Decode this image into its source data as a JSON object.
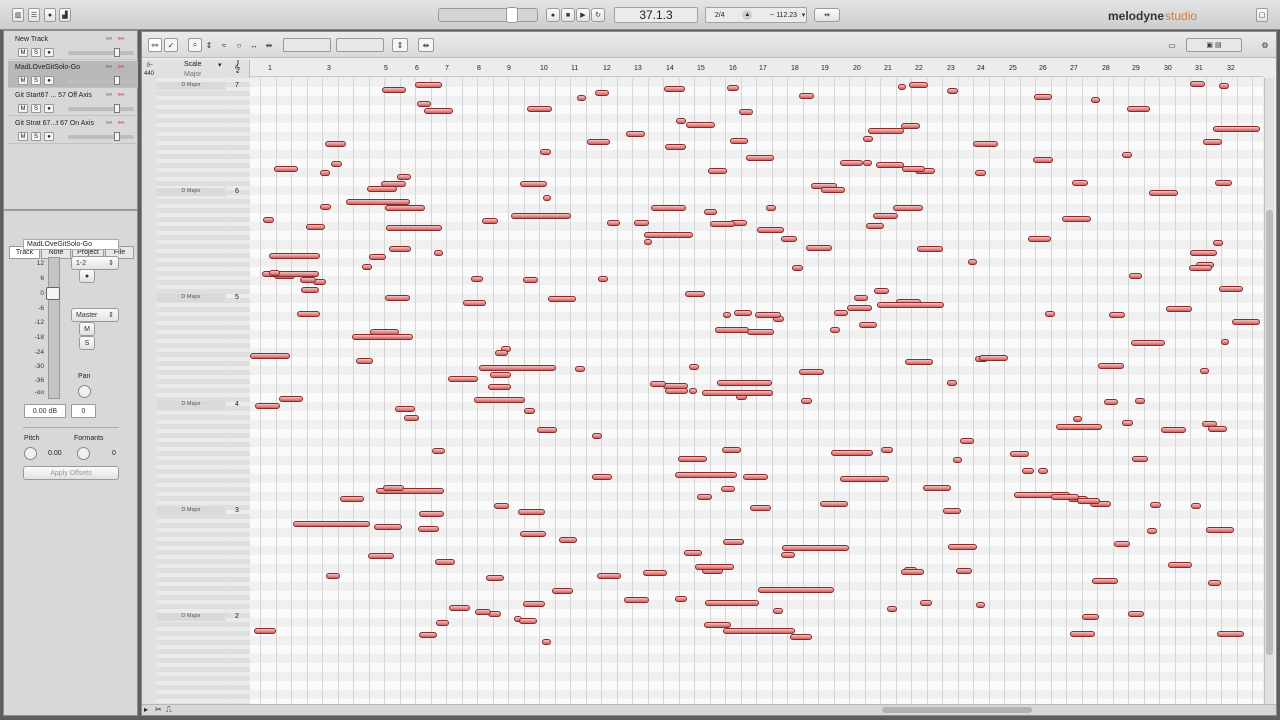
{
  "transport": {
    "position": "37.1.3",
    "signature": "2/4",
    "tempo": "112.23",
    "app_name": "melodyne",
    "app_edition": "studio"
  },
  "tracks": [
    {
      "name": "New Track",
      "selected": false
    },
    {
      "name": "MadLOveGitSolo-Go",
      "selected": true
    },
    {
      "name": "Git Start67 ... 57 Off Axis",
      "selected": false
    },
    {
      "name": "Git Strat 67...t 67 On Axis",
      "selected": false
    }
  ],
  "mini_labels": {
    "mute": "M",
    "solo": "S",
    "record": "●"
  },
  "inspector": {
    "tabs": [
      "Track",
      "Note",
      "Project",
      "File"
    ],
    "track_name": "MadLOveGitSolo-Go",
    "scale": [
      "12",
      "6",
      "0",
      "-6",
      "-12",
      "-18",
      "-24",
      "-30",
      "-36",
      "-oo"
    ],
    "routing": "1-2",
    "output": "Master",
    "mute": "M",
    "solo": "S",
    "pan_label": "Pan",
    "gain": "0.00 dB",
    "pan": "0",
    "pitch_label": "Pitch",
    "pitch_value": "0.00",
    "formants_label": "Formants",
    "formants_value": "0",
    "apply_offsets": "Apply Offsets"
  },
  "editor": {
    "scale_label": "Scale",
    "scale_mode": "Major",
    "tuning": "440",
    "bars": [
      "1",
      "3",
      "5",
      "6",
      "7",
      "8",
      "9",
      "10",
      "11",
      "12",
      "13",
      "14",
      "15",
      "16",
      "17",
      "18",
      "19",
      "20",
      "21",
      "22",
      "23",
      "24",
      "25",
      "26",
      "27",
      "28",
      "29",
      "30",
      "31",
      "32"
    ],
    "octaves": [
      {
        "key": "D Major",
        "num": "7"
      },
      {
        "key": "D Major",
        "num": "6"
      },
      {
        "key": "D Major",
        "num": "5"
      },
      {
        "key": "D Major",
        "num": "4"
      },
      {
        "key": "D Major",
        "num": "3"
      },
      {
        "key": "D Major",
        "num": "2"
      }
    ]
  },
  "colors": {
    "note_fill": "#e08a8a",
    "note_border": "#8a2a2a",
    "accent": "#d9302c"
  }
}
